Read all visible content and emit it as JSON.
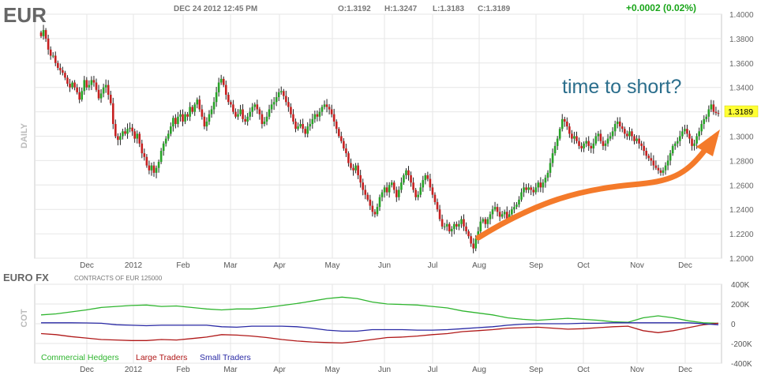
{
  "header": {
    "symbol": "EUR",
    "datetime": "DEC 24 2012 12:45 PM",
    "open": "O:1.3192",
    "high": "H:1.3247",
    "low": "L:1.3183",
    "close": "C:1.3189",
    "change": "+0.0002 (0.02%)",
    "change_color": "#19a519"
  },
  "annotation": {
    "text": "time to short?",
    "color": "#2b6e8c",
    "arrow_color": "#f47a2a"
  },
  "chart_data": [
    {
      "type": "candlestick",
      "panel_label": "DAILY",
      "ylim": [
        1.2,
        1.4
      ],
      "y_ticks": [
        "1.4000",
        "1.3800",
        "1.3600",
        "1.3400",
        "1.3200",
        "1.3000",
        "1.2800",
        "1.2600",
        "1.2400",
        "1.2200",
        "1.2000"
      ],
      "x_ticks": [
        "Dec",
        "2012",
        "Feb",
        "Mar",
        "Apr",
        "May",
        "Jun",
        "Jul",
        "Aug",
        "Sep",
        "Oct",
        "Nov",
        "Dec"
      ],
      "last_price_label": "1.3189",
      "last_price": 1.3189,
      "up_color": "#27a327",
      "down_color": "#c62020",
      "closes": [
        1.382,
        1.387,
        1.38,
        1.371,
        1.366,
        1.366,
        1.36,
        1.356,
        1.354,
        1.352,
        1.348,
        1.343,
        1.34,
        1.344,
        1.34,
        1.336,
        1.33,
        1.337,
        1.346,
        1.34,
        1.342,
        1.346,
        1.344,
        1.338,
        1.331,
        1.335,
        1.34,
        1.342,
        1.334,
        1.327,
        1.31,
        1.3,
        1.297,
        1.3,
        1.304,
        1.302,
        1.306,
        1.307,
        1.304,
        1.298,
        1.302,
        1.294,
        1.286,
        1.283,
        1.276,
        1.272,
        1.276,
        1.27,
        1.274,
        1.279,
        1.288,
        1.294,
        1.298,
        1.302,
        1.308,
        1.315,
        1.31,
        1.316,
        1.318,
        1.312,
        1.318,
        1.316,
        1.324,
        1.32,
        1.326,
        1.33,
        1.322,
        1.316,
        1.308,
        1.312,
        1.318,
        1.322,
        1.328,
        1.336,
        1.344,
        1.347,
        1.342,
        1.334,
        1.328,
        1.326,
        1.32,
        1.316,
        1.318,
        1.322,
        1.314,
        1.312,
        1.316,
        1.32,
        1.324,
        1.326,
        1.322,
        1.318,
        1.31,
        1.312,
        1.316,
        1.322,
        1.326,
        1.328,
        1.332,
        1.336,
        1.337,
        1.333,
        1.328,
        1.324,
        1.318,
        1.312,
        1.306,
        1.308,
        1.31,
        1.306,
        1.302,
        1.308,
        1.31,
        1.314,
        1.318,
        1.316,
        1.32,
        1.324,
        1.326,
        1.324,
        1.322,
        1.318,
        1.312,
        1.306,
        1.3,
        1.296,
        1.29,
        1.286,
        1.278,
        1.274,
        1.272,
        1.276,
        1.268,
        1.262,
        1.256,
        1.252,
        1.248,
        1.243,
        1.238,
        1.236,
        1.242,
        1.25,
        1.254,
        1.258,
        1.254,
        1.26,
        1.262,
        1.256,
        1.25,
        1.256,
        1.262,
        1.268,
        1.272,
        1.268,
        1.262,
        1.256,
        1.25,
        1.252,
        1.258,
        1.264,
        1.268,
        1.265,
        1.258,
        1.252,
        1.246,
        1.24,
        1.232,
        1.226,
        1.226,
        1.228,
        1.222,
        1.224,
        1.228,
        1.226,
        1.228,
        1.232,
        1.226,
        1.222,
        1.218,
        1.212,
        1.208,
        1.216,
        1.222,
        1.23,
        1.232,
        1.228,
        1.232,
        1.236,
        1.24,
        1.242,
        1.238,
        1.234,
        1.236,
        1.238,
        1.232,
        1.236,
        1.24,
        1.242,
        1.244,
        1.248,
        1.254,
        1.258,
        1.256,
        1.258,
        1.256,
        1.254,
        1.258,
        1.262,
        1.258,
        1.262,
        1.266,
        1.27,
        1.278,
        1.286,
        1.292,
        1.298,
        1.306,
        1.314,
        1.312,
        1.308,
        1.302,
        1.298,
        1.3,
        1.296,
        1.292,
        1.29,
        1.294,
        1.296,
        1.292,
        1.29,
        1.294,
        1.3,
        1.302,
        1.296,
        1.292,
        1.294,
        1.298,
        1.3,
        1.304,
        1.31,
        1.312,
        1.308,
        1.306,
        1.302,
        1.3,
        1.304,
        1.3,
        1.296,
        1.298,
        1.294,
        1.292,
        1.288,
        1.284,
        1.282,
        1.28,
        1.276,
        1.274,
        1.272,
        1.27,
        1.272,
        1.276,
        1.28,
        1.286,
        1.292,
        1.294,
        1.296,
        1.3,
        1.304,
        1.306,
        1.302,
        1.298,
        1.292,
        1.294,
        1.3,
        1.304,
        1.31,
        1.314,
        1.316,
        1.322,
        1.326,
        1.32,
        1.319,
        1.3189
      ]
    },
    {
      "type": "line",
      "title": "EURO FX",
      "subtitle": "CONTRACTS OF EUR 125000",
      "panel_label": "COT",
      "ylim": [
        -400000,
        400000
      ],
      "y_ticks": [
        "400K",
        "200K",
        "0",
        "-200K",
        "-400K"
      ],
      "x_ticks": [
        "Dec",
        "2012",
        "Feb",
        "Mar",
        "Apr",
        "May",
        "Jun",
        "Jul",
        "Aug",
        "Sep",
        "Oct",
        "Nov",
        "Dec"
      ],
      "series": [
        {
          "name": "Commercial Hedgers",
          "color": "#2fb52f",
          "values": [
            90000,
            100000,
            120000,
            140000,
            165000,
            175000,
            185000,
            190000,
            175000,
            180000,
            165000,
            150000,
            140000,
            150000,
            150000,
            165000,
            185000,
            205000,
            230000,
            255000,
            270000,
            255000,
            220000,
            200000,
            195000,
            190000,
            175000,
            160000,
            130000,
            110000,
            90000,
            60000,
            45000,
            35000,
            45000,
            55000,
            45000,
            35000,
            20000,
            15000,
            60000,
            80000,
            60000,
            30000,
            10000,
            5000
          ]
        },
        {
          "name": "Large Traders",
          "color": "#b01818",
          "values": [
            -100000,
            -110000,
            -130000,
            -145000,
            -160000,
            -165000,
            -170000,
            -170000,
            -160000,
            -165000,
            -150000,
            -135000,
            -110000,
            -115000,
            -125000,
            -140000,
            -160000,
            -175000,
            -185000,
            -190000,
            -195000,
            -180000,
            -160000,
            -140000,
            -135000,
            -125000,
            -110000,
            -100000,
            -80000,
            -70000,
            -60000,
            -45000,
            -40000,
            -35000,
            -45000,
            -55000,
            -50000,
            -40000,
            -30000,
            -25000,
            -70000,
            -90000,
            -70000,
            -40000,
            -10000,
            5000
          ]
        },
        {
          "name": "Small Traders",
          "color": "#2a2aa5",
          "values": [
            10000,
            10000,
            10000,
            8000,
            5000,
            -10000,
            -15000,
            -20000,
            -15000,
            -15000,
            -15000,
            -15000,
            -30000,
            -35000,
            -25000,
            -25000,
            -25000,
            -30000,
            -45000,
            -65000,
            -75000,
            -75000,
            -60000,
            -60000,
            -60000,
            -65000,
            -65000,
            -60000,
            -50000,
            -40000,
            -30000,
            -15000,
            -5000,
            0,
            0,
            0,
            5000,
            5000,
            10000,
            10000,
            10000,
            10000,
            10000,
            10000,
            0,
            -10000
          ]
        }
      ]
    }
  ]
}
